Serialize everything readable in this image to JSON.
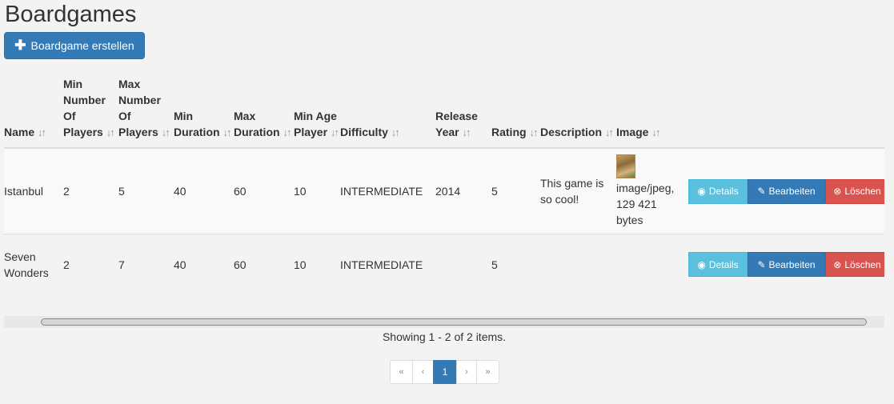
{
  "page": {
    "title": "Boardgames"
  },
  "toolbar": {
    "create_label": "Boardgame erstellen",
    "create_icon": "plus-icon"
  },
  "table": {
    "headers": [
      "Name",
      "Min Number Of Players",
      "Max Number Of Players",
      "Min Duration",
      "Max Duration",
      "Min Age Player",
      "Difficulty",
      "Release Year",
      "Rating",
      "Description",
      "Image"
    ],
    "sort_glyph": "↓↑",
    "rows": [
      {
        "name": "Istanbul",
        "min_players": "2",
        "max_players": "5",
        "min_duration": "40",
        "max_duration": "60",
        "min_age": "10",
        "difficulty": "INTERMEDIATE",
        "release_year": "2014",
        "rating": "5",
        "description": "This game is so cool!",
        "image_info": "image/jpeg, 129 421 bytes"
      },
      {
        "name": "Seven Wonders",
        "min_players": "2",
        "max_players": "7",
        "min_duration": "40",
        "max_duration": "60",
        "min_age": "10",
        "difficulty": "INTERMEDIATE",
        "release_year": "",
        "rating": "5",
        "description": "",
        "image_info": ""
      }
    ],
    "actions": {
      "details": "Details",
      "edit": "Bearbeiten",
      "delete": "Löschen"
    }
  },
  "summary": "Showing 1 - 2 of 2 items.",
  "pagination": {
    "first": "«",
    "prev": "‹",
    "current": "1",
    "next": "›",
    "last": "»"
  },
  "colors": {
    "primary": "#337ab7",
    "info": "#5bc0de",
    "danger": "#d9534f"
  }
}
